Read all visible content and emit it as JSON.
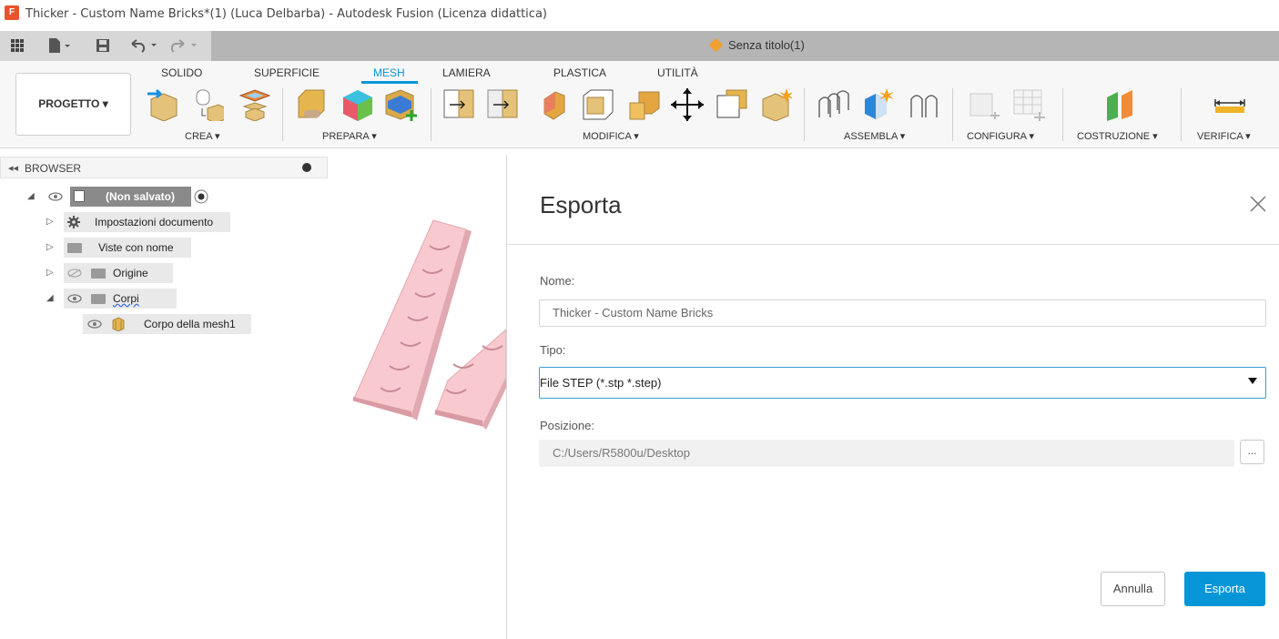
{
  "window": {
    "title": "Thicker - Custom Name Bricks*(1) (Luca Delbarba) - Autodesk Fusion (Licenza didattica)",
    "app_icon_letter": "F"
  },
  "quick_access": {
    "document_tab": "Senza titolo(1)"
  },
  "ribbon": {
    "workspace_button": "PROGETTO ▾",
    "tabs": [
      {
        "label": "SOLIDO"
      },
      {
        "label": "SUPERFICIE"
      },
      {
        "label": "MESH",
        "active": true
      },
      {
        "label": "LAMIERA"
      },
      {
        "label": "PLASTICA"
      },
      {
        "label": "UTILITÀ"
      }
    ],
    "groups": {
      "crea": "CREA ▾",
      "prepara": "PREPARA ▾",
      "modifica": "MODIFICA ▾",
      "assembla": "ASSEMBLA ▾",
      "configura": "CONFIGURA ▾",
      "costruzione": "COSTRUZIONE ▾",
      "verifica": "VERIFICA ▾"
    },
    "accent_color": "#0696d7"
  },
  "browser": {
    "header": "BROWSER",
    "root": "(Non salvato)",
    "items": [
      {
        "label": "Impostazioni documento",
        "icon": "gear-icon"
      },
      {
        "label": "Viste con nome",
        "icon": "folder-icon"
      },
      {
        "label": "Origine",
        "icon": "folder-icon"
      },
      {
        "label": "Corpi",
        "icon": "folder-icon"
      },
      {
        "label": "Corpo della mesh1",
        "icon": "mesh-body-icon"
      }
    ]
  },
  "dialog": {
    "title": "Esporta",
    "name_label": "Nome:",
    "name_value": "Thicker - Custom Name Bricks",
    "type_label": "Tipo:",
    "type_value": "File STEP (*.stp *.step)",
    "location_label": "Posizione:",
    "location_value": "C:/Users/R5800u/Desktop",
    "browse_label": "...",
    "cancel_label": "Annulla",
    "export_label": "Esporta"
  }
}
